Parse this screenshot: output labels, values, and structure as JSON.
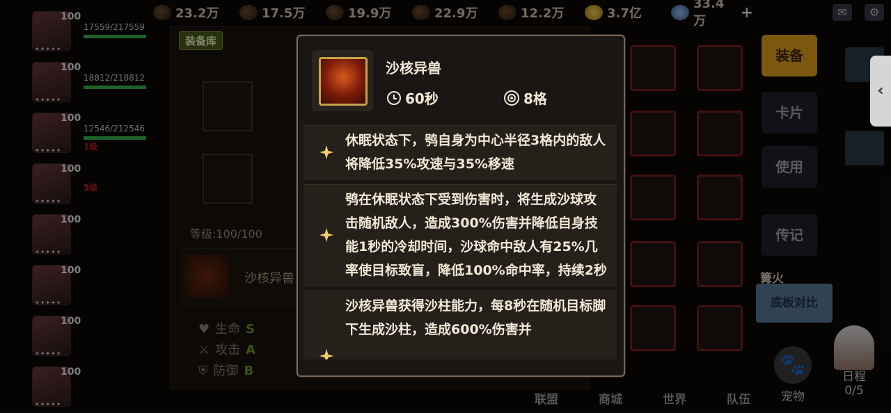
{
  "topbar": {
    "resources": [
      "23.2万",
      "17.5万",
      "19.9万",
      "22.9万",
      "12.2万",
      "3.7亿",
      "33.4万"
    ],
    "plus": "+",
    "icons": [
      "mail-icon",
      "settings-icon"
    ]
  },
  "heroes": [
    {
      "level": "100",
      "hp": "17559/217559",
      "stars": "✦✦✦✦✦"
    },
    {
      "level": "100",
      "hp": "18812/218812",
      "stars": "✦✦✦✦✦"
    },
    {
      "level": "100",
      "hp": "12546/212546",
      "stars": "✦✦✦✦✦",
      "tag": "1级"
    },
    {
      "level": "100",
      "stars": "✦✦✦✦✦",
      "tag": "5级"
    },
    {
      "level": "100",
      "stars": "✦✦✦✦✦"
    },
    {
      "level": "100",
      "stars": "✦✦✦✦✦"
    },
    {
      "level": "100",
      "stars": "✦✦✦✦✦"
    },
    {
      "level": "100",
      "stars": "✦✦✦✦✦"
    }
  ],
  "equip_panel": {
    "library_tag": "装备库",
    "level": "等级:100/100",
    "pet_name": "沙核异兽",
    "stats": [
      {
        "label": "生命",
        "grade": "S"
      },
      {
        "label": "攻击",
        "grade": "A"
      },
      {
        "label": "防御",
        "grade": "B"
      }
    ]
  },
  "side_menu": {
    "items": [
      "装备",
      "卡片",
      "使用",
      "传记"
    ],
    "fire_tag": "篝火",
    "compare_button": "底板对比",
    "pet_button": "宠物",
    "schedule_label": "日程",
    "schedule_count": "0/5",
    "collapse_icon": "‹"
  },
  "bottom_nav": [
    "联盟",
    "商城",
    "世界",
    "队伍"
  ],
  "tooltip": {
    "name": "沙核异兽",
    "cooldown": "60秒",
    "range": "8格",
    "effects": [
      "休眠状态下，鸮自身为中心半径3格内的敌人将降低35%攻速与35%移速",
      "鸮在休眠状态下受到伤害时，将生成沙球攻击随机敌人，造成300%伤害并降低自身技能1秒的冷却时间，沙球命中敌人有25%几率使目标致盲，降低100%命中率，持续2秒",
      "沙核异兽获得沙柱能力，每8秒在随机目标脚下生成沙柱，造成600%伤害并"
    ]
  },
  "colors": {
    "accent_gold": "#e0a11a",
    "star_gold": "#f3cf6a",
    "panel_border": "#7a6858",
    "hp_green": "#39b54a"
  }
}
